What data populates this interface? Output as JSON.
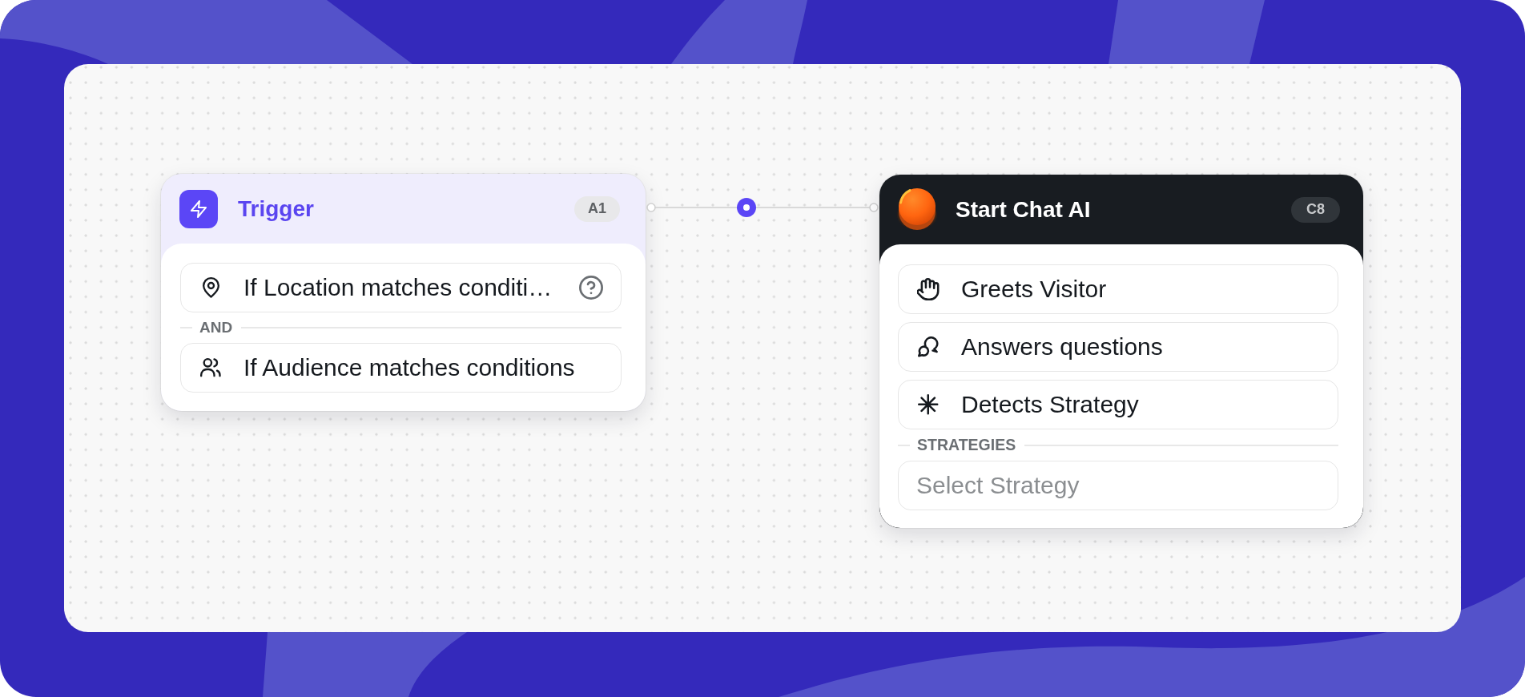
{
  "canvas": {
    "nodes": [
      {
        "kind": "trigger",
        "title": "Trigger",
        "badge": "A1",
        "conditions": [
          {
            "text": "If Location matches conditi…",
            "help": true
          },
          {
            "text": "If Audience matches conditions",
            "help": false
          }
        ],
        "joiner": "AND"
      },
      {
        "kind": "agent",
        "title": "Start Chat AI",
        "badge": "C8",
        "skills": [
          "Greets Visitor",
          "Answers questions",
          "Detects Strategy"
        ],
        "section": {
          "label": "STRATEGIES",
          "select": {
            "placeholder": "Select Strategy"
          }
        }
      }
    ]
  }
}
